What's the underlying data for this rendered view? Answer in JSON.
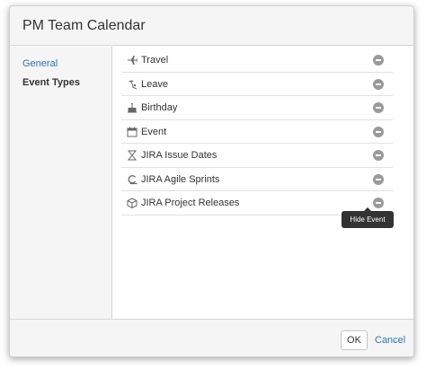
{
  "dialog": {
    "title": "PM Team Calendar"
  },
  "nav": {
    "general": "General",
    "event_types": "Event Types"
  },
  "event_types": [
    {
      "label": "Travel",
      "icon": "airplane-icon"
    },
    {
      "label": "Leave",
      "icon": "beach-icon"
    },
    {
      "label": "Birthday",
      "icon": "cake-icon"
    },
    {
      "label": "Event",
      "icon": "calendar-icon"
    },
    {
      "label": "JIRA Issue Dates",
      "icon": "hourglass-icon"
    },
    {
      "label": "JIRA Agile Sprints",
      "icon": "sprint-icon"
    },
    {
      "label": "JIRA Project Releases",
      "icon": "box-icon"
    }
  ],
  "tooltip": {
    "text": "Hide Event"
  },
  "footer": {
    "ok_label": "OK",
    "cancel_label": "Cancel"
  },
  "colors": {
    "link": "#3572b0",
    "panel_bg": "#f5f5f5",
    "tooltip_bg": "#333333",
    "remove_icon": "#9a9a9a"
  }
}
